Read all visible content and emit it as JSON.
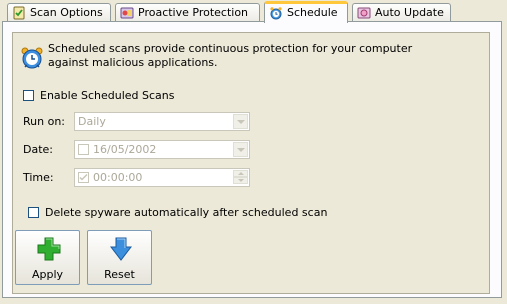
{
  "tabs": [
    {
      "label": "Scan Options",
      "icon": "scan-options-icon",
      "active": false
    },
    {
      "label": "Proactive Protection",
      "icon": "proactive-protection-icon",
      "active": false
    },
    {
      "label": "Schedule",
      "icon": "alarm-clock-icon",
      "active": true
    },
    {
      "label": "Auto Update",
      "icon": "auto-update-icon",
      "active": false
    }
  ],
  "schedule": {
    "info_line1": "Scheduled scans provide continuous protection for your computer",
    "info_line2": "against malicious applications.",
    "enable_label": "Enable Scheduled Scans",
    "enable_checked": false,
    "run_on_label": "Run on:",
    "run_on_value": "Daily",
    "date_label": "Date:",
    "date_value": "16/05/2002",
    "time_label": "Time:",
    "time_value": "00:00:00",
    "delete_label": "Delete spyware automatically after scheduled scan",
    "delete_checked": false
  },
  "buttons": {
    "apply_label": "Apply",
    "reset_label": "Reset"
  },
  "colors": {
    "window_bg": "#ece9d8",
    "active_tab_accent": "#ffc83c",
    "disabled_text": "#aca899",
    "apply_icon": "#2fae2f",
    "reset_icon": "#3b8fdc"
  }
}
